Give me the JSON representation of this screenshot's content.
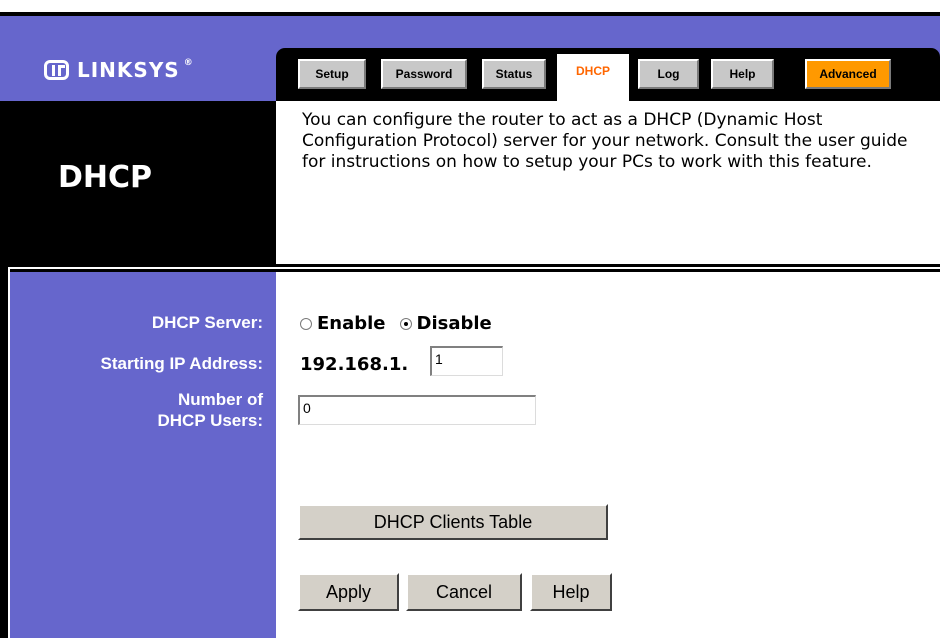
{
  "brand": {
    "name": "LINKSYS",
    "registered_mark": "®"
  },
  "tabs": [
    {
      "label": "Setup",
      "active": false
    },
    {
      "label": "Password",
      "active": false
    },
    {
      "label": "Status",
      "active": false
    },
    {
      "label": "DHCP",
      "active": true
    },
    {
      "label": "Log",
      "active": false
    },
    {
      "label": "Help",
      "active": false
    },
    {
      "label": "Advanced",
      "active": false
    }
  ],
  "page": {
    "title": "DHCP",
    "description": "You can configure the router to act as a DHCP (Dynamic Host Configuration Protocol) server for your network. Consult the user guide for instructions on how to setup your PCs to work with this feature."
  },
  "form": {
    "dhcp_server_label": "DHCP Server:",
    "enable_label": "Enable",
    "disable_label": "Disable",
    "selected": "Disable",
    "starting_ip_label": "Starting IP Address:",
    "ip_prefix": "192.168.1.",
    "ip_last_octet": "1",
    "num_users_label_line1": "Number of",
    "num_users_label_line2": "DHCP Users:",
    "num_users_value": "0"
  },
  "buttons": {
    "clients_table": "DHCP Clients Table",
    "apply": "Apply",
    "cancel": "Cancel",
    "help": "Help"
  },
  "colors": {
    "banner": "#6666cc",
    "active_tab_text": "#ff6600",
    "advanced_tab": "#ff9900"
  }
}
